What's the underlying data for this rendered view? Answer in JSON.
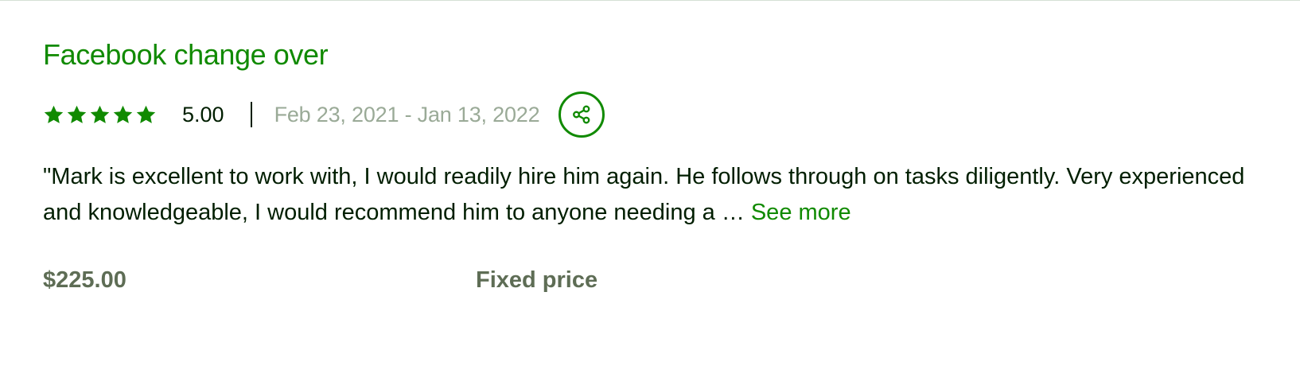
{
  "job": {
    "title": "Facebook change over",
    "rating": {
      "stars_filled": 5,
      "stars_total": 5,
      "score": "5.00"
    },
    "date_range": "Feb 23, 2021 - Jan 13, 2022",
    "feedback": "\"Mark is excellent to work with, I would readily hire him again. He follows through on tasks diligently. Very experienced and knowledgeable, I would recommend him to anyone needing a …",
    "see_more_label": "See more",
    "amount": "$225.00",
    "price_type": "Fixed price"
  },
  "icons": {
    "star": "star-icon",
    "share": "share-icon"
  },
  "colors": {
    "brand_green": "#108a00",
    "text_primary": "#001e00",
    "text_muted": "#9aaa97",
    "text_secondary": "#5e6d55",
    "divider": "#d5e0d5"
  }
}
